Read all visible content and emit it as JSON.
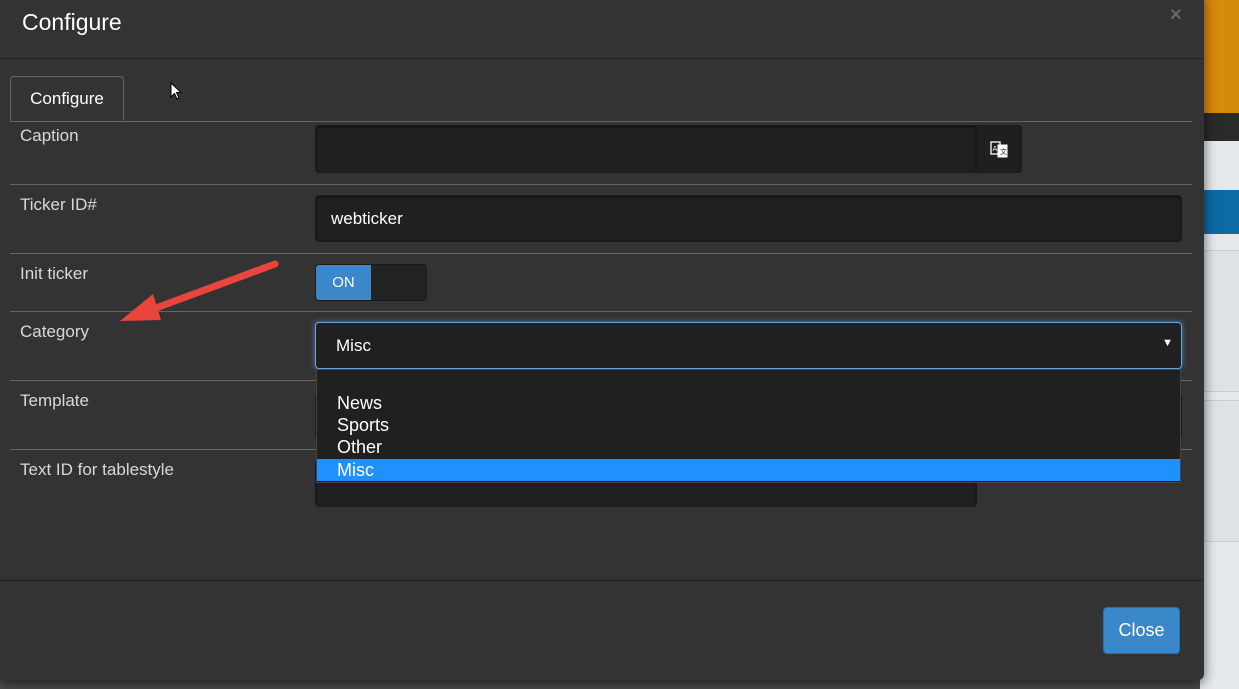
{
  "modal": {
    "title": "Configure"
  },
  "tabs": [
    {
      "label": "Configure"
    }
  ],
  "fields": {
    "caption": {
      "label": "Caption",
      "value": ""
    },
    "ticker_id": {
      "label": "Ticker ID#",
      "value": "webticker"
    },
    "init_ticker": {
      "label": "Init ticker",
      "toggle_label": "ON"
    },
    "category": {
      "label": "Category",
      "value": "Misc"
    },
    "template": {
      "label": "Template"
    },
    "text_id": {
      "label": "Text ID for tablestyle",
      "value": ""
    }
  },
  "category_options": [
    "News",
    "Sports",
    "Other",
    "Misc"
  ],
  "footer": {
    "close_label": "Close"
  },
  "colors": {
    "accent": "#3a87c9",
    "selected_option": "#1e90ff",
    "annotation_arrow": "#e8453c"
  }
}
